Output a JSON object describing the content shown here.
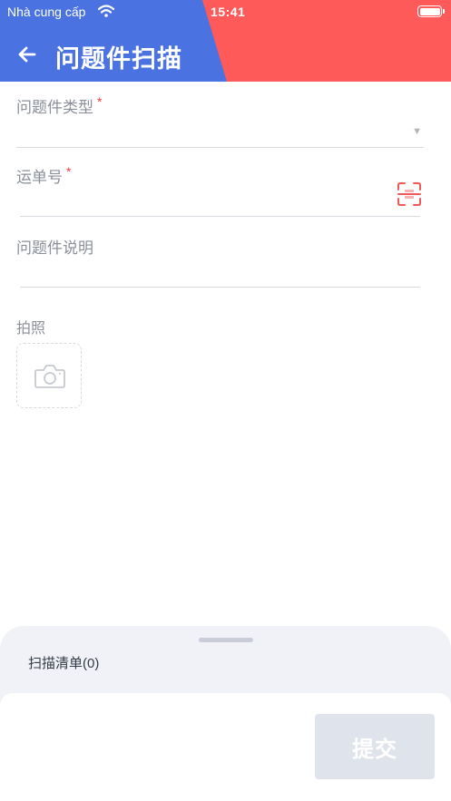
{
  "status_bar": {
    "carrier": "Nhà cung cấp",
    "time": "15:41"
  },
  "header": {
    "title": "问题件扫描",
    "back_icon": "arrow-left-icon"
  },
  "form": {
    "type_field": {
      "label": "问题件类型",
      "required_mark": "*",
      "value": "",
      "dropdown_icon": "caret-down-icon"
    },
    "waybill_field": {
      "label": "运单号",
      "required_mark": "*",
      "value": "",
      "scan_icon": "scan-icon"
    },
    "description_field": {
      "label": "问题件说明",
      "value": ""
    },
    "photo_field": {
      "label": "拍照",
      "icon": "camera-icon"
    }
  },
  "sheet": {
    "title": "扫描清单(0)"
  },
  "footer": {
    "submit_label": "提交"
  },
  "colors": {
    "header_blue": "#4a72e0",
    "header_red": "#ff5a5a",
    "required": "#ff3b3b",
    "scan_icon": "#f0595a",
    "submit_disabled": "#dfe3ec"
  }
}
